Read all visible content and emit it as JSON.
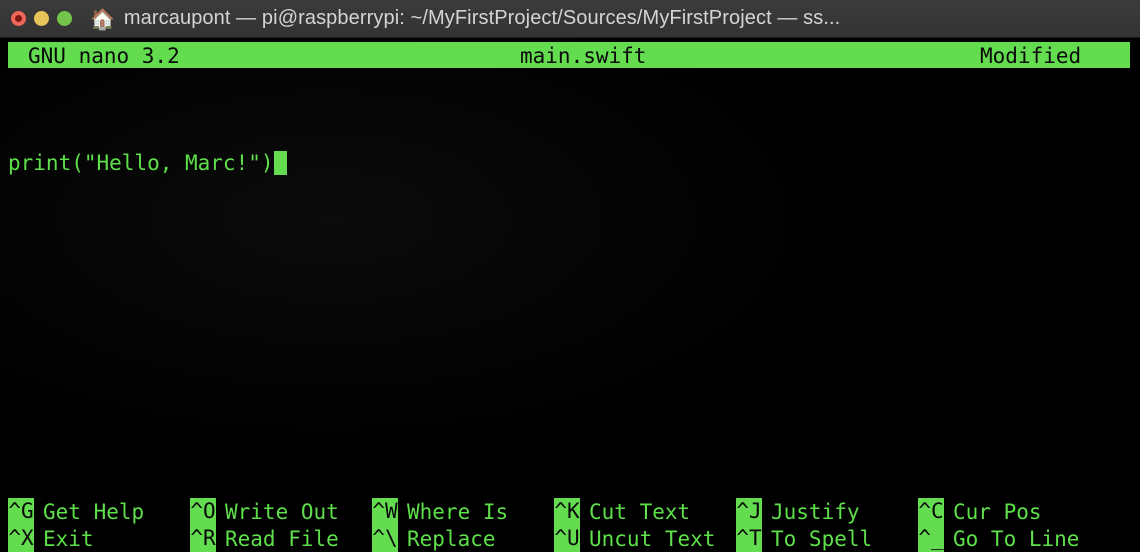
{
  "window": {
    "title": "marcaupont — pi@raspberrypi: ~/MyFirstProject/Sources/MyFirstProject — ss...",
    "home_icon": "🏠",
    "controls": {
      "close_label": "",
      "minimize_label": "",
      "maximize_label": ""
    }
  },
  "colors": {
    "titlebar_bg": "#383838",
    "titlebar_text": "#d4d4d4",
    "terminal_bg": "#000000",
    "nano_accent_green": "#63dc4f",
    "terminal_text_green": "#5ee04a",
    "reverse_text": "#0a0a0a"
  },
  "nano": {
    "version": "GNU nano 3.2",
    "filename": "main.swift",
    "status": "Modified",
    "buffer_lines": [
      "print(\"Hello, Marc!\")"
    ],
    "cursor": {
      "line": 1,
      "column": 22,
      "style": "block"
    },
    "shortcuts_row1": [
      {
        "key": "^G",
        "label": "Get Help"
      },
      {
        "key": "^O",
        "label": "Write Out"
      },
      {
        "key": "^W",
        "label": "Where Is"
      },
      {
        "key": "^K",
        "label": "Cut Text"
      },
      {
        "key": "^J",
        "label": "Justify"
      },
      {
        "key": "^C",
        "label": "Cur Pos"
      }
    ],
    "shortcuts_row2": [
      {
        "key": "^X",
        "label": "Exit"
      },
      {
        "key": "^R",
        "label": "Read File"
      },
      {
        "key": "^\\",
        "label": "Replace"
      },
      {
        "key": "^U",
        "label": "Uncut Text"
      },
      {
        "key": "^T",
        "label": "To Spell"
      },
      {
        "key": "^_",
        "label": "Go To Line"
      }
    ]
  }
}
